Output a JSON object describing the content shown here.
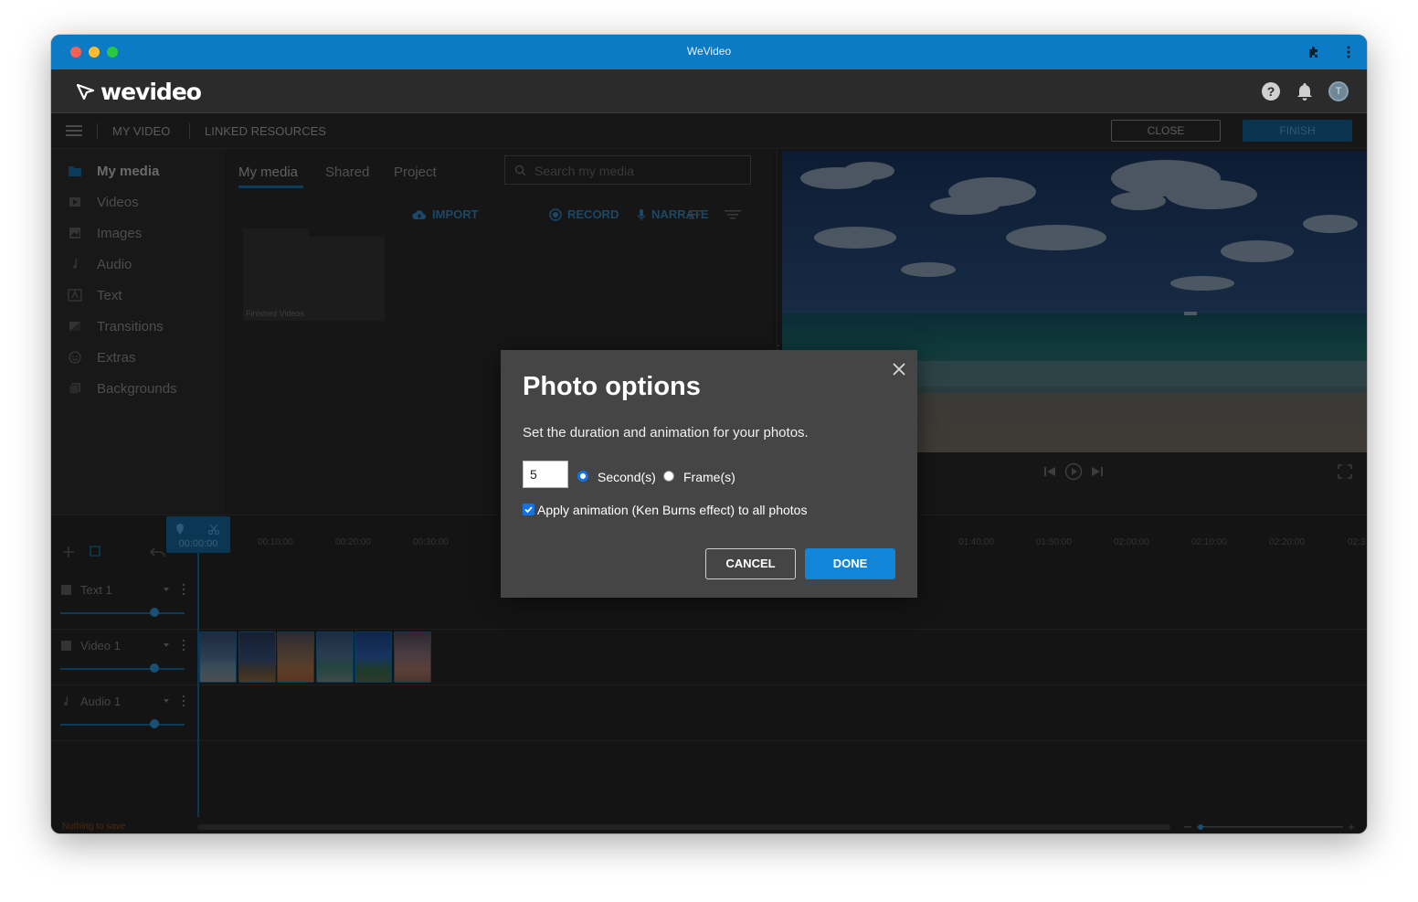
{
  "window": {
    "title": "WeVideo"
  },
  "app": {
    "logo_text": "wevideo",
    "icons": [
      "help-icon",
      "bell-icon",
      "avatar"
    ],
    "avatar_initial": "T"
  },
  "menubar": {
    "items": [
      "MY VIDEO",
      "LINKED RESOURCES"
    ],
    "close_label": "CLOSE",
    "finish_label": "FINISH"
  },
  "sidebar": {
    "items": [
      {
        "label": "My media",
        "icon": "folder-icon",
        "active": true
      },
      {
        "label": "Videos",
        "icon": "film-icon"
      },
      {
        "label": "Images",
        "icon": "image-icon"
      },
      {
        "label": "Audio",
        "icon": "music-note-icon"
      },
      {
        "label": "Text",
        "icon": "text-icon"
      },
      {
        "label": "Transitions",
        "icon": "transition-icon"
      },
      {
        "label": "Extras",
        "icon": "smiley-icon"
      },
      {
        "label": "Backgrounds",
        "icon": "backgrounds-icon"
      }
    ]
  },
  "media": {
    "tabs": [
      "My media",
      "Shared",
      "Project"
    ],
    "search_placeholder": "Search my media",
    "actions": [
      "IMPORT",
      "RECORD",
      "NARRATE"
    ],
    "folder_label": "Finished Videos"
  },
  "timeline": {
    "playhead_time": "00:00:00",
    "ticks": [
      "00:10:00",
      "00:20:00",
      "00:30:00",
      "01:40:00",
      "01:50:00",
      "02:00:00",
      "02:10:00",
      "02:20:00",
      "02:3"
    ],
    "tracks": [
      "Text 1",
      "Video 1",
      "Audio 1"
    ],
    "clip_count": 6,
    "status": "Nothing to save"
  },
  "modal": {
    "title": "Photo options",
    "description": "Set the duration and animation for your photos.",
    "duration_value": "5",
    "unit_seconds": "Second(s)",
    "unit_frames": "Frame(s)",
    "selected_unit": "seconds",
    "ken_burns_label": "Apply animation (Ken Burns effect) to all photos",
    "ken_burns_checked": true,
    "cancel_label": "CANCEL",
    "done_label": "DONE"
  },
  "colors": {
    "titlebar": "#0a7bc4",
    "accent": "#1185d8",
    "modal_bg": "#454545"
  }
}
